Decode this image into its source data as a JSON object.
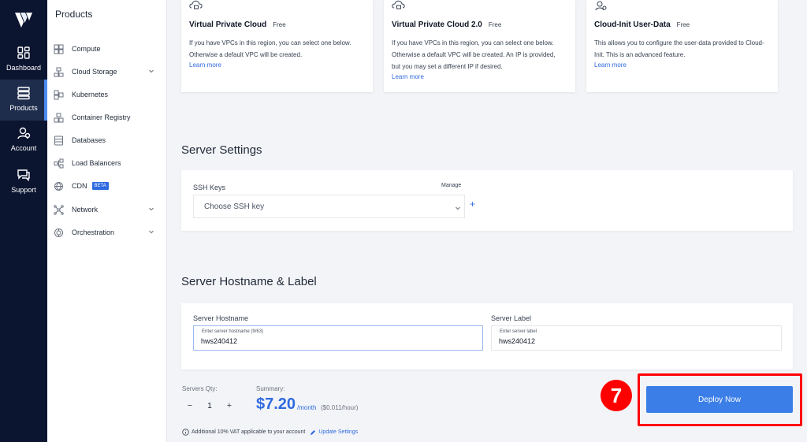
{
  "rail": {
    "items": [
      {
        "label": "Dashboard"
      },
      {
        "label": "Products"
      },
      {
        "label": "Account"
      },
      {
        "label": "Support"
      }
    ]
  },
  "menu": {
    "title": "Products",
    "items": [
      {
        "label": "Compute"
      },
      {
        "label": "Cloud Storage"
      },
      {
        "label": "Kubernetes"
      },
      {
        "label": "Container Registry"
      },
      {
        "label": "Databases"
      },
      {
        "label": "Load Balancers"
      },
      {
        "label": "CDN",
        "badge": "BETA"
      },
      {
        "label": "Network"
      },
      {
        "label": "Orchestration"
      }
    ]
  },
  "vpc_cards": [
    {
      "name": "Virtual Private Cloud",
      "price": "Free",
      "desc_lines": [
        "If you have VPCs in this region, you can select one below.",
        "Otherwise a default VPC will be created."
      ],
      "link": "Learn more"
    },
    {
      "name": "Virtual Private Cloud 2.0",
      "price": "Free",
      "desc_lines": [
        "If you have VPCs in this region, you can select one below.",
        "Otherwise a default VPC will be created. An IP is provided,",
        "but you may set a different IP if desired."
      ],
      "link": "Learn more"
    },
    {
      "name": "Cloud-Init User-Data",
      "price": "Free",
      "desc_lines": [
        "This allows you to configure the user-data provided to Cloud-",
        "Init. This is an advanced feature."
      ],
      "link": "Learn more"
    }
  ],
  "server_settings": {
    "title": "Server Settings",
    "ssh_label": "SSH Keys",
    "manage": "Manage",
    "ssh_select": "Choose SSH key",
    "plus": "+"
  },
  "hostname_section": {
    "title": "Server Hostname & Label",
    "hostname_label": "Server Hostname",
    "hostname_placeholder": "Enter server hostname (9/63)",
    "hostname_value": "hws240412",
    "label_label": "Server Label",
    "label_placeholder": "Enter server label",
    "label_value": "hws240412"
  },
  "footer": {
    "qty_label": "Servers Qty:",
    "minus": "−",
    "qty": "1",
    "plus": "+",
    "summary_label": "Summary:",
    "price": "$7.20",
    "per_month": "/month",
    "per_hour": "($0.011/hour)",
    "vat_text": "Additional 10% VAT applicable to your account",
    "update_link": "Update Settings",
    "deploy": "Deploy Now",
    "step": "7"
  },
  "colors": {
    "accent": "#3b7ee8",
    "rail": "#0b1530",
    "highlight": "#ff0000"
  }
}
